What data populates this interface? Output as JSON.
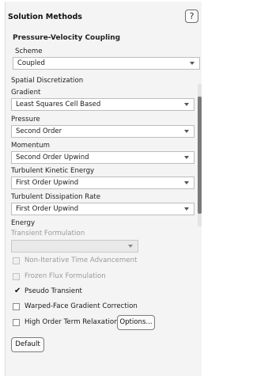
{
  "panel": {
    "title": "Solution Methods",
    "help_icon": "question-mark-icon",
    "help_glyph": "?"
  },
  "pressure_velocity": {
    "heading": "Pressure-Velocity Coupling",
    "scheme_label": "Scheme",
    "scheme_value": "Coupled"
  },
  "spatial": {
    "heading": "Spatial Discretization",
    "items": [
      {
        "label": "Gradient",
        "value": "Least Squares Cell Based"
      },
      {
        "label": "Pressure",
        "value": "Second Order"
      },
      {
        "label": "Momentum",
        "value": "Second Order Upwind"
      },
      {
        "label": "Turbulent Kinetic Energy",
        "value": "First Order Upwind"
      },
      {
        "label": "Turbulent Dissipation Rate",
        "value": "First Order Upwind"
      },
      {
        "label": "Energy",
        "value": ""
      }
    ]
  },
  "transient": {
    "label": "Transient Formulation",
    "value": ""
  },
  "options": {
    "non_iterative": "Non-Iterative Time Advancement",
    "frozen_flux": "Frozen Flux Formulation",
    "pseudo_transient": "Pseudo Transient",
    "warped_face": "Warped-Face Gradient Correction",
    "high_order": "High Order Term Relaxation",
    "options_button": "Options...",
    "check_glyph": "✔"
  },
  "footer": {
    "default_button": "Default"
  }
}
